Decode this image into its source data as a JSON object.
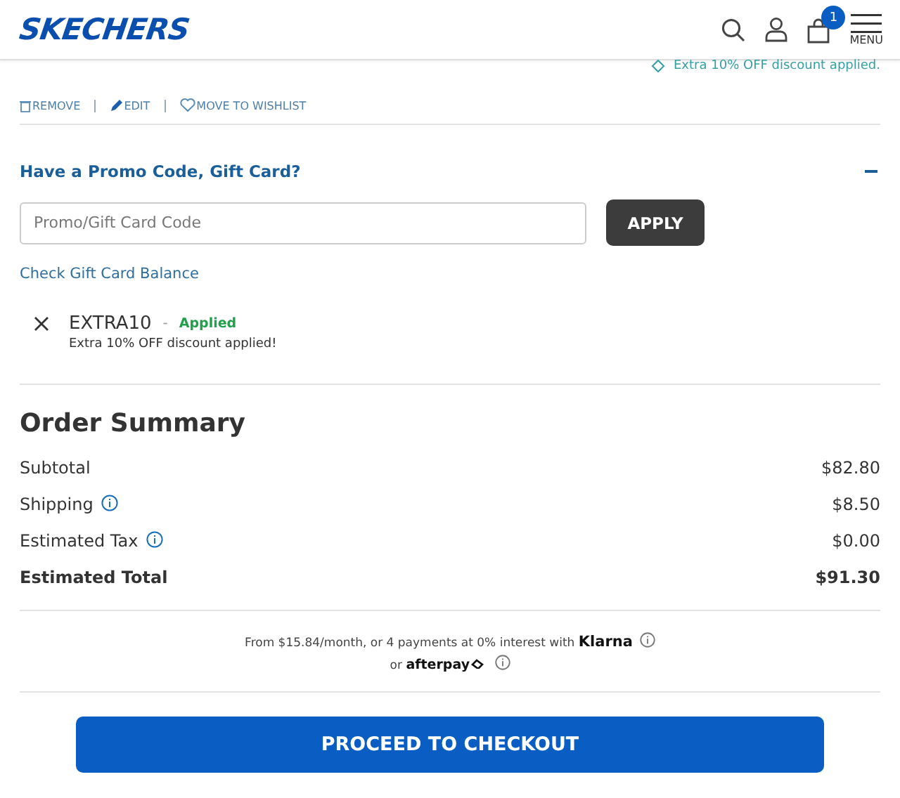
{
  "header": {
    "logo": "SKECHERS",
    "cart_count": "1",
    "menu_label": "MENU"
  },
  "discount_note": "Extra 10% OFF discount applied.",
  "item_actions": [
    "REMOVE",
    "EDIT",
    "MOVE TO WISHLIST"
  ],
  "promo": {
    "title": "Have a Promo Code, Gift Card?",
    "expanded": true,
    "placeholder": "Promo/Gift Card Code",
    "apply": "APPLY",
    "balance_link": "Check Gift Card Balance",
    "applied_code": {
      "code": "EXTRA10",
      "separator": "-",
      "status": "Applied",
      "description": "Extra 10% OFF discount applied!"
    }
  },
  "summary": {
    "title": "Order Summary",
    "rows": [
      {
        "label": "Subtotal",
        "value": "$82.80",
        "info": false,
        "bold": false
      },
      {
        "label": "Shipping",
        "value": "$8.50",
        "info": true,
        "bold": false
      },
      {
        "label": "Estimated Tax",
        "value": "$0.00",
        "info": true,
        "bold": false
      },
      {
        "label": "Estimated Total",
        "value": "$91.30",
        "info": false,
        "bold": true
      }
    ]
  },
  "financing": {
    "klarna_text": "From $15.84/month, or 4 payments at 0% interest with",
    "klarna": "Klarna",
    "or": "or",
    "afterpay": "afterpay"
  },
  "checkout": "PROCEED TO CHECKOUT"
}
